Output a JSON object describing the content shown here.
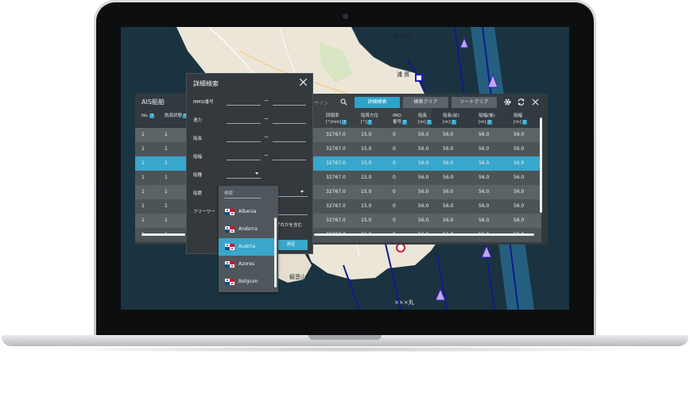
{
  "map": {
    "labels": [
      "東京湾",
      "浦 賀",
      "観音山",
      "×××丸"
    ],
    "colors": {
      "sea": "#1b3340",
      "land": "#ece6d8",
      "channel": "#0d1b8f",
      "zone": "#2d84b4"
    }
  },
  "ais": {
    "title": "AIS船舶",
    "search_hint": "サイン",
    "buttons": {
      "detail": "詳細検索",
      "clear": "検索クリア",
      "sort": "ソートクリア"
    },
    "columns": [
      {
        "label": "No.",
        "help": true
      },
      {
        "label": "航海状態",
        "help": true
      },
      {
        "label": "回頭率\n[°/min]",
        "help": true
      },
      {
        "label": "船首方位\n[°]",
        "help": true
      },
      {
        "label": "IMO\n番号",
        "help": true
      },
      {
        "label": "船長\n[m]",
        "help": true
      },
      {
        "label": "船長(前)\n[m]",
        "help": true
      },
      {
        "label": "船幅(後)\n[m]",
        "help": true
      },
      {
        "label": "船幅\n[m]",
        "help": true
      }
    ],
    "rows": [
      [
        "1",
        "1",
        "32767.0",
        "15.0",
        "0",
        "56.0",
        "56.0",
        "56.0",
        "56.0"
      ],
      [
        "1",
        "1",
        "32767.0",
        "15.0",
        "0",
        "56.0",
        "56.0",
        "56.0",
        "56.0"
      ],
      [
        "1",
        "1",
        "32767.0",
        "15.0",
        "0",
        "56.0",
        "56.0",
        "56.0",
        "56.0"
      ],
      [
        "1",
        "1",
        "32767.0",
        "15.0",
        "0",
        "56.0",
        "56.0",
        "56.0",
        "56.0"
      ],
      [
        "1",
        "1",
        "32767.0",
        "15.0",
        "0",
        "56.0",
        "56.0",
        "56.0",
        "56.0"
      ],
      [
        "1",
        "1",
        "32767.0",
        "15.0",
        "0",
        "56.0",
        "56.0",
        "56.0",
        "56.0"
      ],
      [
        "1",
        "1",
        "32767.0",
        "15.0",
        "0",
        "56.0",
        "56.0",
        "56.0",
        "56.0"
      ],
      [
        "1",
        "1",
        "32767.0",
        "15.0",
        "0",
        "56.0",
        "56.0",
        "56.0",
        "56.0"
      ]
    ],
    "selected_row": 2
  },
  "search_dialog": {
    "title": "詳細検索",
    "fields": [
      {
        "label": "MMSI番号",
        "type": "range"
      },
      {
        "label": "速力",
        "type": "range"
      },
      {
        "label": "船長",
        "type": "range"
      },
      {
        "label": "船幅",
        "type": "range"
      },
      {
        "label": "船種",
        "type": "select"
      },
      {
        "label": "船籍",
        "type": "select"
      },
      {
        "label": "フリーワー",
        "type": "text"
      }
    ],
    "range_separator": "~",
    "free_option": "ずれかを含む",
    "submit": "決定"
  },
  "country_dropdown": {
    "placeholder": "検索",
    "options": [
      "Albenia",
      "Andorra",
      "Austria",
      "Azores",
      "Belgium"
    ],
    "selected": "Austria"
  }
}
